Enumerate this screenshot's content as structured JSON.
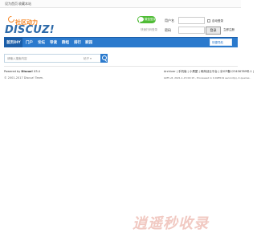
{
  "topbar": {
    "left_link": "设为首页",
    "right_link": "收藏本站"
  },
  "logo": {
    "cn": "社区动力",
    "en": "DISCUZ!"
  },
  "login": {
    "pill_text": "微信登录注册",
    "qr_tip": "快速扫码登录",
    "username_label": "用户名",
    "password_label": "密码",
    "remember_label": "自动登录",
    "find_password": "找回密码",
    "register": "立即注册",
    "login_button": "登录"
  },
  "nav": {
    "items": [
      "首页DIY",
      "门户",
      "论坛",
      "导读",
      "群组",
      "排行",
      "家园"
    ],
    "right_box": "快捷导航"
  },
  "search": {
    "placeholder": "请输入搜索内容",
    "type": "帖子",
    "type_arrow": "▾"
  },
  "footer": {
    "powered": "Powered by",
    "brand": "Discuz!",
    "version": "X3.4",
    "copyright": "© 2001-2017 Discuz! Team.",
    "right_links": "Archiver | 手机版 | 小黑屋 | 网商创业平台 | 京ICP备123456789号-1 |",
    "right_info": "GMT+8, 2021-1-15 00:15 , Processed in 0.028519 second(s), 4 queries ."
  },
  "watermark": {
    "text": "逍遥秒收录"
  },
  "colors": {
    "nav": "#2b7acd",
    "logo_accent": "#f58220",
    "pill": "#4fbc36",
    "watermark": "#f1c9c2"
  },
  "icons": {
    "search": "search-icon",
    "pill": "chat-icon"
  }
}
